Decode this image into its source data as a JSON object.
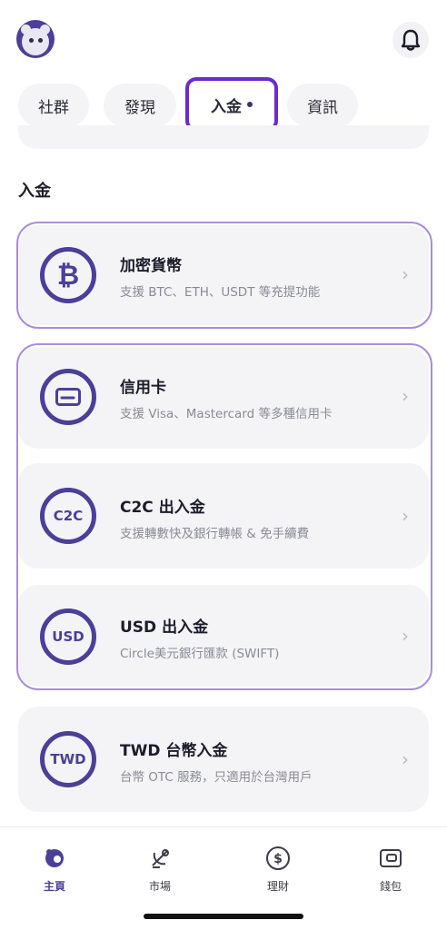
{
  "header": {
    "avatar_icon": "bear-avatar",
    "notification_icon": "bell-icon"
  },
  "tabs": [
    {
      "label": "社群",
      "active": false
    },
    {
      "label": "發現",
      "active": false
    },
    {
      "label": "入金",
      "active": true
    },
    {
      "label": "資訊",
      "active": false
    }
  ],
  "section": {
    "title": "入金"
  },
  "options": [
    {
      "title": "加密貨幣",
      "desc": "支援 BTC、ETH、USDT 等充提功能",
      "icon": "bitcoin-icon",
      "icon_text": "₿"
    },
    {
      "title": "信用卡",
      "desc": "支援 Visa、Mastercard 等多種信用卡",
      "icon": "credit-card-icon",
      "icon_text": ""
    },
    {
      "title": "C2C 出入金",
      "desc": "支援轉數快及銀行轉帳 & 免手續費",
      "icon": "c2c-icon",
      "icon_text": "C2C"
    },
    {
      "title": "USD 出入金",
      "desc": "Circle美元銀行匯款 (SWIFT)",
      "icon": "usd-icon",
      "icon_text": "USD"
    },
    {
      "title": "TWD 台幣入金",
      "desc": "台幣 OTC 服務，只適用於台灣用戶",
      "icon": "twd-icon",
      "icon_text": "TWD"
    }
  ],
  "bottom_nav": [
    {
      "label": "主頁",
      "icon": "home-icon",
      "active": true
    },
    {
      "label": "市場",
      "icon": "market-icon",
      "active": false
    },
    {
      "label": "理財",
      "icon": "finance-icon",
      "active": false
    },
    {
      "label": "錢包",
      "icon": "wallet-icon",
      "active": false
    }
  ],
  "colors": {
    "accent": "#4b3f9a",
    "highlight": "#6a2bd0",
    "card_bg": "#f4f4f7"
  }
}
